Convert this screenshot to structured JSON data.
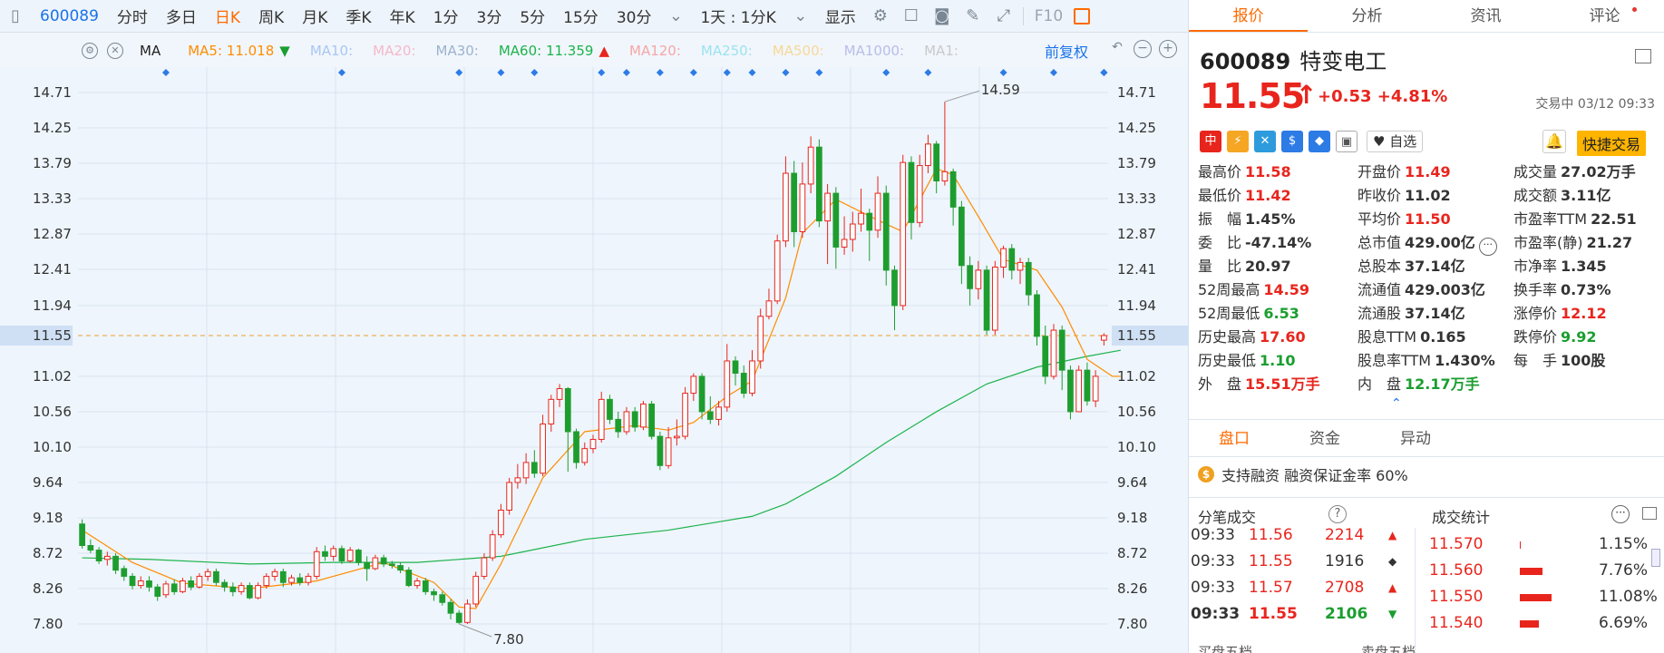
{
  "toolbar": {
    "code": "600089",
    "items": [
      "分时",
      "多日",
      "日K",
      "周K",
      "月K",
      "季K",
      "年K",
      "1分",
      "3分",
      "5分",
      "15分",
      "30分"
    ],
    "active_index": 2,
    "period_select": "1天 : 1分K",
    "display_label": "显示",
    "f10": "F10"
  },
  "mabar": {
    "name": "MA",
    "mas": [
      {
        "label": "MA5: 11.018",
        "color": "#ff8c00",
        "arrow": "down"
      },
      {
        "label": "MA10:",
        "color": "#a9c7f2"
      },
      {
        "label": "MA20:",
        "color": "#f5b8c8"
      },
      {
        "label": "MA30:",
        "color": "#9bb3ce"
      },
      {
        "label": "MA60: 11.359",
        "color": "#1db34c",
        "arrow": "up"
      },
      {
        "label": "MA120:",
        "color": "#f5a6a6"
      },
      {
        "label": "MA250:",
        "color": "#9be3ef"
      },
      {
        "label": "MA500:",
        "color": "#f7d896"
      },
      {
        "label": "MA1000:",
        "color": "#b9bde8"
      },
      {
        "label": "MA1:",
        "color": "#c9c9c9"
      }
    ],
    "fuquan": "前复权"
  },
  "chart_data": {
    "type": "candlestick",
    "y_ticks": [
      "14.71",
      "14.25",
      "13.79",
      "13.33",
      "12.87",
      "12.41",
      "11.94",
      "11.55",
      "11.02",
      "10.56",
      "10.10",
      "9.64",
      "9.18",
      "8.72",
      "8.26",
      "7.80"
    ],
    "ylim": [
      7.8,
      14.71
    ],
    "current_price": "11.55",
    "max_label": "14.59",
    "min_label": "7.80",
    "colors": {
      "up": "#e8251d",
      "down": "#1e9d2f",
      "ma5": "#ff8c00",
      "ma60": "#1db34c",
      "grid": "#d9e4ef"
    },
    "candles": [
      [
        9.1,
        8.82,
        9.16,
        8.78
      ],
      [
        8.82,
        8.76,
        8.9,
        8.72
      ],
      [
        8.76,
        8.62,
        8.8,
        8.58
      ],
      [
        8.64,
        8.68,
        8.74,
        8.56
      ],
      [
        8.68,
        8.5,
        8.72,
        8.45
      ],
      [
        8.52,
        8.42,
        8.56,
        8.36
      ],
      [
        8.42,
        8.3,
        8.46,
        8.25
      ],
      [
        8.3,
        8.36,
        8.42,
        8.26
      ],
      [
        8.36,
        8.28,
        8.42,
        8.22
      ],
      [
        8.28,
        8.16,
        8.32,
        8.1
      ],
      [
        8.18,
        8.32,
        8.36,
        8.14
      ],
      [
        8.32,
        8.22,
        8.38,
        8.18
      ],
      [
        8.22,
        8.36,
        8.4,
        8.2
      ],
      [
        8.36,
        8.28,
        8.42,
        8.24
      ],
      [
        8.28,
        8.42,
        8.46,
        8.26
      ],
      [
        8.42,
        8.48,
        8.52,
        8.36
      ],
      [
        8.48,
        8.34,
        8.52,
        8.3
      ],
      [
        8.34,
        8.28,
        8.38,
        8.22
      ],
      [
        8.28,
        8.22,
        8.34,
        8.16
      ],
      [
        8.22,
        8.3,
        8.34,
        8.18
      ],
      [
        8.3,
        8.14,
        8.34,
        8.12
      ],
      [
        8.14,
        8.3,
        8.34,
        8.12
      ],
      [
        8.3,
        8.42,
        8.46,
        8.26
      ],
      [
        8.42,
        8.48,
        8.52,
        8.36
      ],
      [
        8.48,
        8.34,
        8.52,
        8.28
      ],
      [
        8.34,
        8.4,
        8.44,
        8.3
      ],
      [
        8.4,
        8.34,
        8.46,
        8.3
      ],
      [
        8.34,
        8.42,
        8.46,
        8.3
      ],
      [
        8.42,
        8.74,
        8.8,
        8.38
      ],
      [
        8.74,
        8.68,
        8.82,
        8.62
      ],
      [
        8.68,
        8.78,
        8.82,
        8.62
      ],
      [
        8.78,
        8.62,
        8.82,
        8.58
      ],
      [
        8.62,
        8.76,
        8.8,
        8.6
      ],
      [
        8.76,
        8.6,
        8.78,
        8.56
      ],
      [
        8.6,
        8.52,
        8.68,
        8.36
      ],
      [
        8.52,
        8.66,
        8.7,
        8.5
      ],
      [
        8.66,
        8.58,
        8.7,
        8.54
      ],
      [
        8.58,
        8.56,
        8.62,
        8.52
      ],
      [
        8.56,
        8.5,
        8.6,
        8.46
      ],
      [
        8.5,
        8.3,
        8.54,
        8.28
      ],
      [
        8.3,
        8.36,
        8.4,
        8.26
      ],
      [
        8.36,
        8.22,
        8.4,
        8.18
      ],
      [
        8.22,
        8.18,
        8.26,
        8.1
      ],
      [
        8.18,
        8.08,
        8.22,
        8.04
      ],
      [
        8.08,
        7.94,
        8.12,
        7.86
      ],
      [
        7.94,
        7.82,
        7.98,
        7.8
      ],
      [
        7.82,
        8.06,
        8.12,
        7.8
      ],
      [
        8.06,
        8.42,
        8.48,
        8.02
      ],
      [
        8.42,
        8.66,
        8.72,
        8.38
      ],
      [
        8.66,
        8.96,
        9.02,
        8.62
      ],
      [
        8.96,
        9.28,
        9.36,
        8.92
      ],
      [
        9.28,
        9.64,
        9.7,
        9.22
      ],
      [
        9.64,
        9.7,
        9.88,
        9.56
      ],
      [
        9.7,
        9.9,
        10.02,
        9.62
      ],
      [
        9.9,
        9.76,
        10.06,
        9.7
      ],
      [
        9.76,
        10.4,
        10.52,
        9.72
      ],
      [
        10.4,
        10.72,
        10.78,
        10.3
      ],
      [
        10.72,
        10.86,
        10.92,
        10.62
      ],
      [
        10.86,
        10.3,
        10.88,
        9.78
      ],
      [
        10.3,
        9.9,
        10.34,
        9.82
      ],
      [
        9.9,
        10.08,
        10.16,
        9.86
      ],
      [
        10.08,
        10.2,
        10.26,
        10.02
      ],
      [
        10.2,
        10.72,
        10.82,
        10.16
      ],
      [
        10.72,
        10.46,
        10.78,
        10.4
      ],
      [
        10.46,
        10.3,
        10.56,
        10.22
      ],
      [
        10.3,
        10.56,
        10.62,
        10.26
      ],
      [
        10.56,
        10.36,
        10.62,
        10.3
      ],
      [
        10.36,
        10.66,
        10.7,
        10.32
      ],
      [
        10.66,
        10.24,
        10.7,
        10.2
      ],
      [
        10.24,
        9.86,
        10.3,
        9.8
      ],
      [
        9.86,
        10.22,
        10.36,
        9.82
      ],
      [
        10.22,
        10.24,
        10.46,
        10.12
      ],
      [
        10.24,
        10.8,
        10.88,
        10.2
      ],
      [
        10.8,
        11.02,
        11.06,
        10.7
      ],
      [
        11.02,
        10.56,
        11.06,
        10.46
      ],
      [
        10.56,
        10.46,
        10.76,
        10.4
      ],
      [
        10.46,
        10.62,
        10.7,
        10.38
      ],
      [
        10.62,
        11.22,
        11.44,
        10.56
      ],
      [
        11.22,
        11.06,
        11.28,
        10.9
      ],
      [
        11.06,
        10.8,
        11.16,
        10.74
      ],
      [
        10.8,
        11.22,
        11.36,
        10.76
      ],
      [
        11.22,
        11.8,
        11.9,
        11.12
      ],
      [
        11.8,
        12.0,
        12.16,
        11.76
      ],
      [
        12.0,
        12.78,
        12.86,
        11.96
      ],
      [
        12.78,
        13.66,
        13.88,
        12.7
      ],
      [
        13.66,
        12.9,
        13.82,
        12.7
      ],
      [
        12.9,
        13.52,
        13.8,
        12.82
      ],
      [
        13.52,
        14.0,
        14.14,
        13.4
      ],
      [
        14.0,
        13.04,
        14.1,
        12.96
      ],
      [
        13.04,
        13.4,
        13.52,
        12.48
      ],
      [
        13.4,
        12.7,
        13.48,
        12.42
      ],
      [
        12.7,
        12.8,
        13.1,
        12.6
      ],
      [
        12.8,
        13.0,
        13.16,
        12.64
      ],
      [
        13.0,
        13.14,
        13.46,
        12.9
      ],
      [
        13.14,
        12.92,
        13.2,
        12.52
      ],
      [
        12.92,
        13.4,
        13.62,
        12.82
      ],
      [
        13.4,
        12.4,
        13.5,
        12.2
      ],
      [
        12.4,
        11.94,
        12.46,
        11.62
      ],
      [
        11.94,
        13.8,
        13.9,
        11.88
      ],
      [
        13.8,
        13.02,
        13.88,
        12.8
      ],
      [
        13.02,
        13.76,
        13.9,
        12.96
      ],
      [
        13.76,
        14.04,
        14.16,
        13.66
      ],
      [
        14.04,
        13.56,
        14.08,
        13.4
      ],
      [
        13.56,
        13.68,
        14.59,
        13.5
      ],
      [
        13.68,
        13.22,
        13.72,
        12.98
      ],
      [
        13.22,
        12.46,
        13.3,
        12.22
      ],
      [
        12.46,
        12.16,
        12.58,
        11.94
      ],
      [
        12.16,
        12.4,
        12.52,
        12.02
      ],
      [
        12.4,
        11.62,
        12.46,
        11.56
      ],
      [
        11.62,
        12.44,
        12.52,
        11.56
      ],
      [
        12.44,
        12.68,
        12.72,
        12.3
      ],
      [
        12.68,
        12.4,
        12.74,
        12.28
      ],
      [
        12.4,
        12.5,
        12.56,
        12.22
      ],
      [
        12.5,
        12.08,
        12.56,
        11.94
      ],
      [
        12.08,
        11.54,
        12.14,
        11.42
      ],
      [
        11.54,
        11.02,
        11.68,
        10.92
      ],
      [
        11.02,
        11.62,
        11.7,
        10.98
      ],
      [
        11.62,
        11.1,
        11.68,
        10.84
      ],
      [
        11.1,
        10.56,
        11.16,
        10.46
      ],
      [
        10.56,
        11.1,
        11.16,
        10.6
      ],
      [
        11.1,
        10.7,
        11.2,
        10.64
      ],
      [
        10.7,
        11.02,
        11.1,
        10.62
      ],
      [
        11.49,
        11.55,
        11.58,
        11.42
      ]
    ],
    "ma5_line": [
      [
        0,
        9.02
      ],
      [
        6,
        8.6
      ],
      [
        12,
        8.33
      ],
      [
        20,
        8.26
      ],
      [
        28,
        8.36
      ],
      [
        36,
        8.6
      ],
      [
        42,
        8.34
      ],
      [
        45,
        8.02
      ],
      [
        47,
        8.0
      ],
      [
        50,
        8.58
      ],
      [
        55,
        9.7
      ],
      [
        60,
        10.3
      ],
      [
        66,
        10.38
      ],
      [
        70,
        10.32
      ],
      [
        73,
        10.42
      ],
      [
        77,
        10.76
      ],
      [
        80,
        10.96
      ],
      [
        84,
        12.04
      ],
      [
        86,
        12.88
      ],
      [
        90,
        13.32
      ],
      [
        95,
        13.05
      ],
      [
        98,
        12.9
      ],
      [
        102,
        13.72
      ],
      [
        104,
        13.64
      ],
      [
        107,
        13.1
      ],
      [
        110,
        12.54
      ],
      [
        114,
        12.4
      ],
      [
        117,
        11.92
      ],
      [
        120,
        11.24
      ],
      [
        123,
        11.02
      ],
      [
        124,
        11.02
      ]
    ],
    "ma60_line": [
      [
        0,
        8.66
      ],
      [
        8,
        8.64
      ],
      [
        20,
        8.58
      ],
      [
        30,
        8.6
      ],
      [
        40,
        8.6
      ],
      [
        50,
        8.68
      ],
      [
        60,
        8.9
      ],
      [
        70,
        9.02
      ],
      [
        80,
        9.2
      ],
      [
        84,
        9.36
      ],
      [
        90,
        9.72
      ],
      [
        96,
        10.16
      ],
      [
        102,
        10.56
      ],
      [
        108,
        10.92
      ],
      [
        114,
        11.14
      ],
      [
        120,
        11.28
      ],
      [
        124,
        11.359
      ]
    ],
    "event_markers": [
      10,
      31,
      45,
      50,
      54,
      62,
      65,
      69,
      73,
      77,
      80,
      84,
      88,
      96,
      101,
      110,
      116,
      122,
      127,
      131
    ]
  },
  "panel": {
    "tabs": [
      "报价",
      "分析",
      "资讯",
      "评论"
    ],
    "code": "600089",
    "name": "特变电工",
    "price": "11.55",
    "change": "+0.53  +4.81%",
    "status": "交易中 03/12 09:33",
    "badges": [
      "中",
      "⚡",
      "✕",
      "$",
      "◆",
      "▣"
    ],
    "watch": "自选",
    "quick_trade": "快捷交易",
    "quote_rows": [
      [
        [
          "最高价",
          "11.58",
          "red"
        ],
        [
          "开盘价",
          "11.49",
          "red"
        ],
        [
          "成交量",
          "27.02万手",
          "dark"
        ]
      ],
      [
        [
          "最低价",
          "11.42",
          "red"
        ],
        [
          "昨收价",
          "11.02",
          "dark"
        ],
        [
          "成交额",
          "3.11亿",
          "dark"
        ]
      ],
      [
        [
          "振　幅",
          "1.45%",
          "dark"
        ],
        [
          "平均价",
          "11.50",
          "red"
        ],
        [
          "市盈率TTM",
          "22.51",
          "dark"
        ]
      ],
      [
        [
          "委　比",
          "-47.14%",
          "dark"
        ],
        [
          "总市值",
          "429.00亿",
          "dark"
        ],
        [
          "市盈率(静)",
          "21.27",
          "dark"
        ]
      ],
      [
        [
          "量　比",
          "20.97",
          "dark"
        ],
        [
          "总股本",
          "37.14亿",
          "dark"
        ],
        [
          "市净率",
          "1.345",
          "dark"
        ]
      ],
      [
        [
          "52周最高",
          "14.59",
          "red"
        ],
        [
          "流通值",
          "429.003亿",
          "dark"
        ],
        [
          "换手率",
          "0.73%",
          "dark"
        ]
      ],
      [
        [
          "52周最低",
          "6.53",
          "green"
        ],
        [
          "流通股",
          "37.14亿",
          "dark"
        ],
        [
          "涨停价",
          "12.12",
          "red"
        ]
      ],
      [
        [
          "历史最高",
          "17.60",
          "red"
        ],
        [
          "股息TTM",
          "0.165",
          "dark"
        ],
        [
          "跌停价",
          "9.92",
          "green"
        ]
      ],
      [
        [
          "历史最低",
          "1.10",
          "green"
        ],
        [
          "股息率TTM",
          "1.430%",
          "dark"
        ],
        [
          "每　手",
          "100股",
          "dark"
        ]
      ],
      [
        [
          "外　盘",
          "15.51万手",
          "red"
        ],
        [
          "内　盘",
          "12.17万手",
          "green"
        ],
        [
          "",
          ""
        ]
      ]
    ],
    "subtabs": [
      "盘口",
      "资金",
      "异动"
    ],
    "margin_text": "支持融资 融资保证金率 60%",
    "tick_title": "分笔成交",
    "stats_title": "成交统计",
    "ticks": [
      [
        "09:33",
        "11.56",
        "2214",
        "▲",
        "red"
      ],
      [
        "09:33",
        "11.55",
        "1916",
        "◆",
        "dark"
      ],
      [
        "09:33",
        "11.57",
        "2708",
        "▲",
        "red"
      ],
      [
        "09:33",
        "11.55",
        "2106",
        "▼",
        "green"
      ]
    ],
    "stats": [
      [
        "11.570",
        "1.15%",
        0.02
      ],
      [
        "11.560",
        "7.76%",
        0.35
      ],
      [
        "11.550",
        "11.08%",
        0.5
      ],
      [
        "11.540",
        "6.69%",
        0.3
      ]
    ],
    "foot": "买盘五档　　　　　　　　卖盘五档"
  }
}
